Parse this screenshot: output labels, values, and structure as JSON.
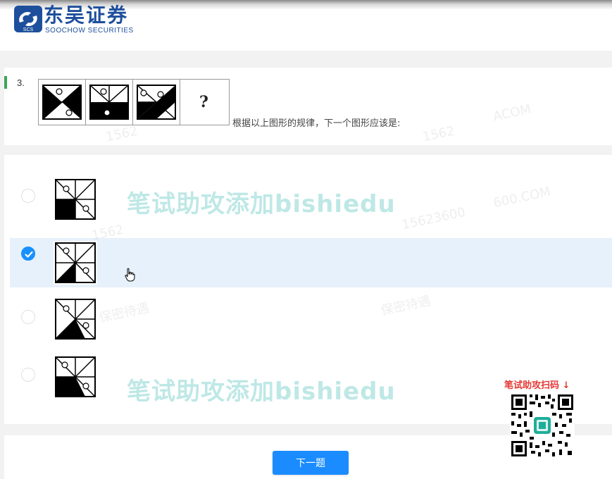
{
  "brand": {
    "name_cn": "东吴证券",
    "name_en": "SOOCHOW SECURITIES",
    "mark_text": "SCS",
    "color": "#1d4f9c"
  },
  "question": {
    "number": "3.",
    "text": "根据以上图形的规律，下一个图形应该是:",
    "placeholder_symbol": "?",
    "accent_color": "#3aa655"
  },
  "options": [
    {
      "selected": false,
      "figure": "option-a"
    },
    {
      "selected": true,
      "figure": "option-b"
    },
    {
      "selected": false,
      "figure": "option-c"
    },
    {
      "selected": false,
      "figure": "option-d"
    }
  ],
  "watermarks": {
    "primary": "笔试助攻添加bishiedu",
    "secondary": "笔试助攻添加bishiedu",
    "faint_texts": [
      "1562",
      "1562",
      "15623600",
      "ACOM",
      "1562",
      "保密待遇",
      "保密待遇",
      "600.COM"
    ]
  },
  "qr": {
    "label": "笔试助攻扫码",
    "arrow": "↓",
    "label_color": "#e53935"
  },
  "footer": {
    "next_label": "下一题",
    "button_color": "#1a8cff"
  },
  "colors": {
    "selected_row": "#e6f1fc",
    "radio_checked": "#1890ff"
  }
}
